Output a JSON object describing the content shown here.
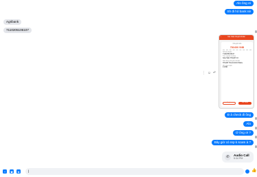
{
  "messages": {
    "out_top": [
      "Alo ông ơi",
      "Sh đi hỏ bank nè"
    ],
    "in": [
      "Agribank",
      "7110205106107"
    ],
    "out_bottom": [
      "Đ ả check đi ông",
      "Alo",
      "Ơ ông ơi ?",
      "Bây giờ có rep k scam à ?"
    ]
  },
  "attachment": {
    "header": "Xác nhận chuyển khoản",
    "card_title": "Chuyển tiền",
    "amount": "700.000 VNĐ",
    "rows": [
      {
        "label": "Số tài khoản",
        "value": "7110205106107"
      },
      {
        "label": "Tên người hưởng",
        "value": "NGUYEN THANH XX"
      },
      {
        "label": "Nội dung chuyển khoản",
        "value": "THANH TOAN DON HANG"
      },
      {
        "label": "Phí giao dịch",
        "value": "0 VND"
      }
    ],
    "cancel_label": "Hủy bỏ",
    "confirm_label": "Xác nhận"
  },
  "call": {
    "title": "Audio Call",
    "time": "5:34 PM"
  },
  "composer": {
    "placeholder": "Aa",
    "value": "|"
  },
  "colors": {
    "accent": "#0a7cff",
    "incoming": "#e4e6eb",
    "bank_orange": "#e9461f"
  }
}
